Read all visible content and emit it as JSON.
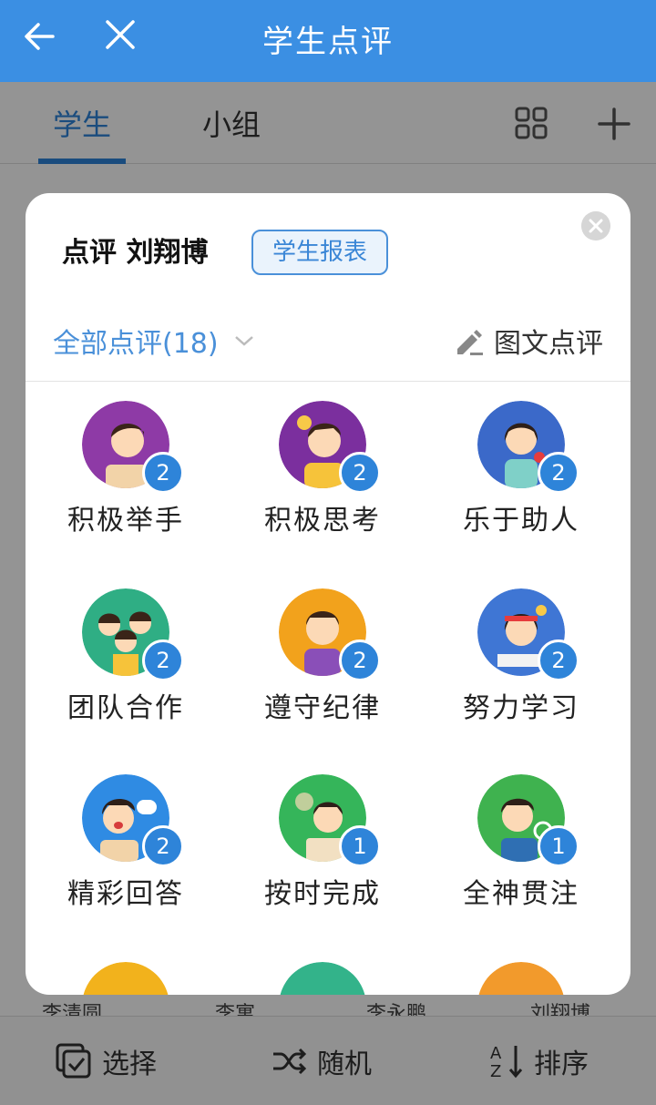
{
  "appbar": {
    "title": "学生点评"
  },
  "tabs": [
    {
      "label": "学生"
    },
    {
      "label": "小组"
    }
  ],
  "background_names": [
    "李清圆",
    "李寓",
    "李永鹏",
    "刘翔博"
  ],
  "bottombar": {
    "select": "选择",
    "random": "随机",
    "sort": "排序"
  },
  "dialog": {
    "title": "点评 刘翔博",
    "report_button": "学生报表",
    "filter": "全部点评(18)",
    "image_comment": "图文点评",
    "items": [
      {
        "label": "积极举手",
        "count": "2",
        "color": "#8e3aa6"
      },
      {
        "label": "积极思考",
        "count": "2",
        "color": "#7b2f9e"
      },
      {
        "label": "乐于助人",
        "count": "2",
        "color": "#3b69c9"
      },
      {
        "label": "团队合作",
        "count": "2",
        "color": "#2fae84"
      },
      {
        "label": "遵守纪律",
        "count": "2",
        "color": "#f2a21c"
      },
      {
        "label": "努力学习",
        "count": "2",
        "color": "#3f76d4"
      },
      {
        "label": "精彩回答",
        "count": "2",
        "color": "#2f8be3"
      },
      {
        "label": "按时完成",
        "count": "1",
        "color": "#35b55a"
      },
      {
        "label": "全神贯注",
        "count": "1",
        "color": "#3fb24f"
      }
    ],
    "partial_row_colors": [
      "#f2b21c",
      "#33b38a",
      "#f29a2c"
    ]
  }
}
